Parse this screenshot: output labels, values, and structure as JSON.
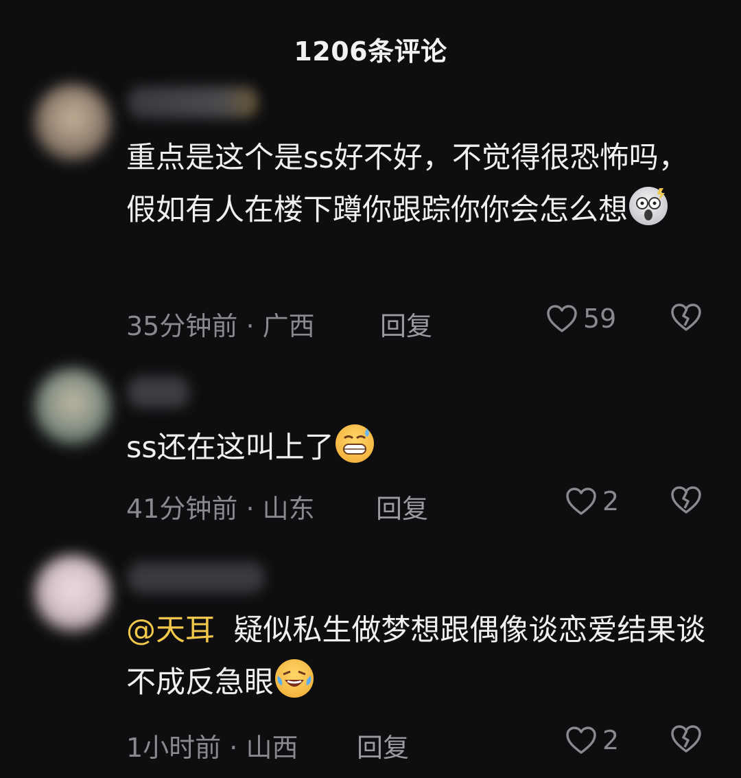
{
  "header": {
    "title": "1206条评论"
  },
  "comments": [
    {
      "text": "重点是这个是ss好不好，不觉得很恐怖吗，假如有人在楼下蹲你跟踪你你会怎么想",
      "emoji": "shocked-face-emoji",
      "time": "35分钟前",
      "location": "广西",
      "reply_label": "回复",
      "likes": "59",
      "avatar_color": "#8a7a6a"
    },
    {
      "text": "ss还在这叫上了",
      "emoji": "grinning-sweat-emoji",
      "time": "41分钟前",
      "location": "山东",
      "reply_label": "回复",
      "likes": "2",
      "avatar_color": "#7c8a7e"
    },
    {
      "mention": "@天耳",
      "text": "疑似私生做梦想跟偶像谈恋爱结果谈不成反急眼",
      "emoji": "laughing-tears-emoji",
      "time": "1小时前",
      "location": "山西",
      "reply_label": "回复",
      "likes": "2",
      "avatar_color": "#c9b8bd"
    }
  ],
  "colors": {
    "background": "#0e0e10",
    "mention": "#f2c84b",
    "meta": "#8a8a8e"
  }
}
